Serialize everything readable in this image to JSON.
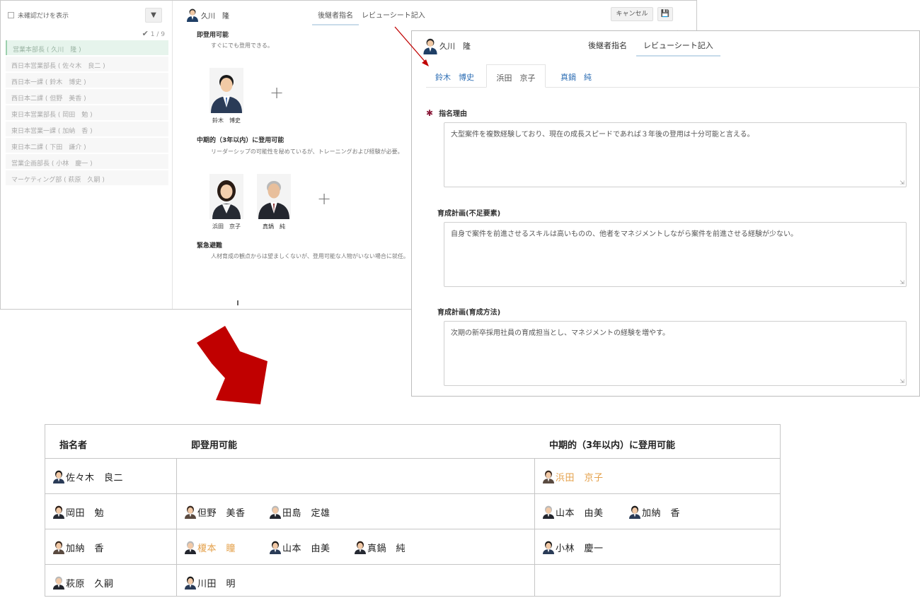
{
  "back_window": {
    "sidebar": {
      "show_unchecked_label": "未確認だけを表示",
      "progress": "1 / 9",
      "items": [
        "営業本部長 ( 久川　隆 )",
        "西日本営業部長 ( 佐々木　良二 )",
        "西日本一課 ( 鈴木　博史 )",
        "西日本二課 ( 但野　美香 )",
        "東日本営業部長 ( 岡田　勉 )",
        "東日本営業一課 ( 加納　香 )",
        "東日本二課 ( 下田　謙介 )",
        "営業企画部長 ( 小林　慶一 )",
        "マーケティング部 ( 萩原　久嗣 )"
      ]
    },
    "main": {
      "user_name": "久川　隆",
      "tabs": [
        "後継者指名",
        "レビューシート記入"
      ],
      "cancel_label": "キャンセル",
      "sections": [
        {
          "title": "即登用可能",
          "desc": "すぐにでも登用できる。"
        },
        {
          "title": "中期的（3年以内）に登用可能",
          "desc": "リーダーシップの可能性を秘めているが、トレーニングおよび経験が必要。"
        },
        {
          "title": "緊急避難",
          "desc": "人材育成の観点からは望ましくないが、登用可能な人物がいない場合に就任。"
        }
      ],
      "immediate_candidates": [
        "鈴木　博史"
      ],
      "midterm_candidates": [
        "浜田　京子",
        "真鍋　純"
      ]
    }
  },
  "front_window": {
    "user_name": "久川　隆",
    "tabs": [
      "後継者指名",
      "レビューシート記入"
    ],
    "candidate_tabs": [
      "鈴木　博史",
      "浜田　京子",
      "真鍋　純"
    ],
    "fields": [
      {
        "label": "指名理由",
        "value": "大型案件を複数経験しており、現在の成長スピードであれば３年後の登用は十分可能と言える。"
      },
      {
        "label": "育成計画(不足要素)",
        "value": "自身で案件を前進させるスキルは高いものの、他者をマネジメントしながら案件を前進させる経験が少ない。"
      },
      {
        "label": "育成計画(育成方法)",
        "value": "次期の新卒採用社員の育成担当とし、マネジメントの経験を増やす。"
      }
    ]
  },
  "table": {
    "headers": [
      "指名者",
      "即登用可能",
      "中期的（3年以内）に登用可能"
    ],
    "rows": [
      {
        "nominator": "佐々木　良二",
        "immediate": [],
        "midterm": [
          {
            "name": "浜田　京子",
            "highlight": true
          }
        ]
      },
      {
        "nominator": "岡田　勉",
        "immediate": [
          {
            "name": "但野　美香"
          },
          {
            "name": "田島　定雄"
          }
        ],
        "midterm": [
          {
            "name": "山本　由美"
          },
          {
            "name": "加納　香"
          }
        ]
      },
      {
        "nominator": "加納　香",
        "immediate": [
          {
            "name": "榎本　瞳",
            "highlight": true
          },
          {
            "name": "山本　由美"
          },
          {
            "name": "真鍋　純"
          }
        ],
        "midterm": [
          {
            "name": "小林　慶一"
          }
        ]
      },
      {
        "nominator": "萩原　久嗣",
        "immediate": [
          {
            "name": "川田　明"
          }
        ],
        "midterm": []
      }
    ]
  },
  "colors": {
    "accent_link": "#2f6fb5",
    "highlight_orange": "#e4a04a",
    "arrow_red": "#c00000",
    "required_star": "#8b1a3a"
  }
}
